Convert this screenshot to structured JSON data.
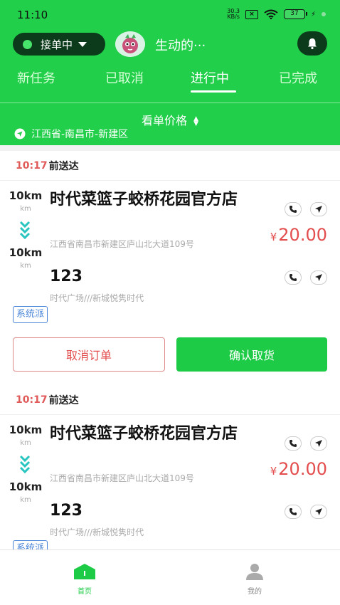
{
  "status_bar": {
    "time": "11:10",
    "net_speed_value": "30.3",
    "net_speed_unit": "KB/s",
    "battery": "37"
  },
  "topbar": {
    "accept_status": "接单中",
    "user_name": "生动的···"
  },
  "tabs": [
    {
      "label": "新任务",
      "active": false
    },
    {
      "label": "已取消",
      "active": false
    },
    {
      "label": "进行中",
      "active": true
    },
    {
      "label": "已完成",
      "active": false
    }
  ],
  "filter": {
    "price_sort": "看单价格",
    "location": "江西省-南昌市-新建区"
  },
  "orders": [
    {
      "deliver_time": "10:17",
      "deliver_suffix": "前送达",
      "pickup_distance": "10km",
      "pickup_unit": "km",
      "drop_distance": "10km",
      "drop_unit": "km",
      "shop_name": "时代菜篮子蛟桥花园官方店",
      "shop_address": "江西省南昌市新建区庐山北大道109号",
      "customer_name": "123",
      "customer_address": "时代广场///新城悦隽时代",
      "price_symbol": "¥",
      "price": "20.00",
      "tag": "系统派",
      "cancel_label": "取消订单",
      "confirm_label": "确认取货"
    },
    {
      "deliver_time": "10:17",
      "deliver_suffix": "前送达",
      "pickup_distance": "10km",
      "pickup_unit": "km",
      "drop_distance": "10km",
      "drop_unit": "km",
      "shop_name": "时代菜篮子蛟桥花园官方店",
      "shop_address": "江西省南昌市新建区庐山北大道109号",
      "customer_name": "123",
      "customer_address": "时代广场///新城悦隽时代",
      "price_symbol": "¥",
      "price": "20.00",
      "tag": "系统派"
    }
  ],
  "bottom_nav": [
    {
      "label": "首页",
      "icon": "home-icon",
      "active": true
    },
    {
      "label": "我的",
      "icon": "profile-icon",
      "active": false
    }
  ],
  "colors": {
    "brand_green": "#21cf4a",
    "dark_green": "#0c3b1c",
    "price_red": "#e34d4d",
    "tag_blue": "#4a86d8"
  }
}
